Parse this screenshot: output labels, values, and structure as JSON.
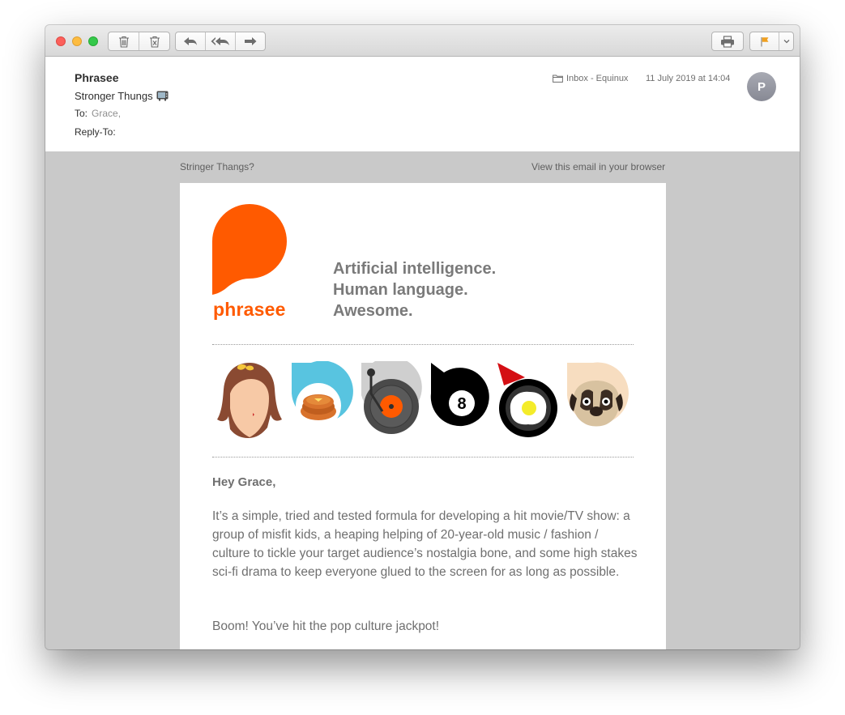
{
  "email": {
    "sender": "Phrasee",
    "subject": "Stronger Thungs",
    "to_label": "To:",
    "to_value": "Grace,",
    "reply_to_label": "Reply-To:",
    "mailbox": "Inbox - Equinux",
    "date": "11 July 2019 at 14:04",
    "avatar_initial": "P"
  },
  "preheader": {
    "left": "Stringer Thangs?",
    "right": "View this email in your browser"
  },
  "content": {
    "brand": "phrasee",
    "tagline": [
      "Artificial intelligence.",
      "Human language.",
      "Awesome."
    ],
    "greeting": "Hey Grace,",
    "paragraph1": "It’s a simple, tried and tested formula for developing a hit movie/TV show: a group of misfit kids, a heaping helping of 20-year-old music / fashion / culture to tickle your target audience’s nostalgia bone, and some high stakes sci-fi drama to keep everyone glued to the screen for as long as possible.",
    "paragraph2": "Boom! You’ve hit the pop culture jackpot!"
  },
  "toolbar": {
    "icons": [
      "trash-icon",
      "junk-icon",
      "reply-icon",
      "reply-all-icon",
      "forward-icon",
      "print-icon",
      "flag-icon",
      "chevron-down-icon"
    ]
  },
  "colors": {
    "brand_orange": "#ff5a00",
    "flag_orange": "#f0a020",
    "close": "#fc605b",
    "minimize": "#fdbc40",
    "zoom": "#34c84a",
    "body_bg": "#c9c9c9"
  }
}
